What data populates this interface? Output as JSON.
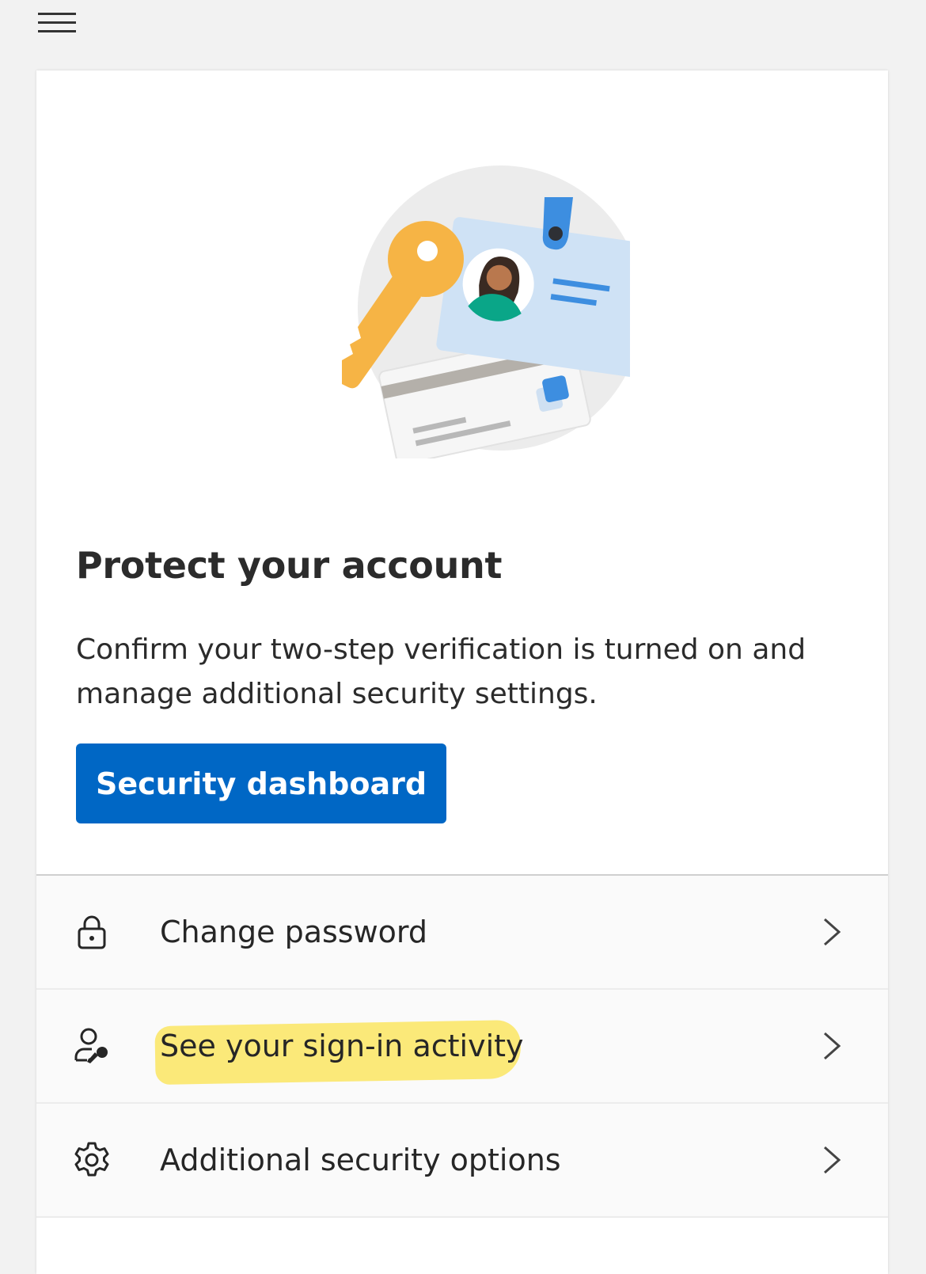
{
  "header": {
    "menu_icon": "hamburger-icon"
  },
  "card": {
    "illustration": "security-keys-illustration",
    "title": "Protect your account",
    "description": "Confirm your two-step verification is turned on and manage additional security settings.",
    "primary_button_label": "Security dashboard"
  },
  "list": {
    "items": [
      {
        "label": "Change password",
        "icon": "lock-icon"
      },
      {
        "label": "See your sign-in activity",
        "icon": "user-key-icon",
        "highlighted": true
      },
      {
        "label": "Additional security options",
        "icon": "gear-icon"
      }
    ]
  },
  "colors": {
    "background": "#f2f2f2",
    "card": "#ffffff",
    "primary": "#0067c5",
    "highlight": "#fbe76a",
    "text": "#262626"
  }
}
